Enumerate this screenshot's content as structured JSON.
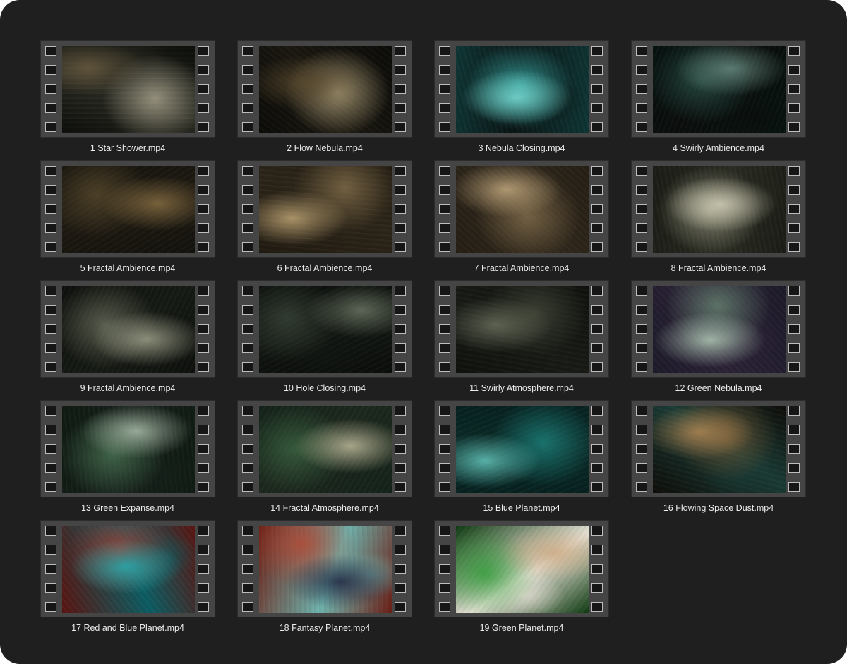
{
  "files": [
    {
      "label": "1 Star Shower.mp4",
      "colors": [
        "#0c0e0a",
        "#b9b39b",
        "#6e5f43",
        "#2a2a22"
      ]
    },
    {
      "label": "2 Flow Nebula.mp4",
      "colors": [
        "#0b0b08",
        "#c7b58a",
        "#5a4a2e",
        "#1a1710"
      ]
    },
    {
      "label": "3 Nebula Closing.mp4",
      "colors": [
        "#0e3534",
        "#3fbfba",
        "#7ee0d8",
        "#0a1414"
      ]
    },
    {
      "label": "4 Swirly Ambience.mp4",
      "colors": [
        "#071310",
        "#2f5b51",
        "#6b8f84",
        "#0a0d0c"
      ]
    },
    {
      "label": "5 Fractal Ambience.mp4",
      "colors": [
        "#13120c",
        "#5d4d2f",
        "#8c7245",
        "#1f1a12"
      ]
    },
    {
      "label": "6 Fractal Ambience.mp4",
      "colors": [
        "#201a11",
        "#8c7650",
        "#c9ae7b",
        "#2b2418"
      ]
    },
    {
      "label": "7 Fractal Ambience.mp4",
      "colors": [
        "#251e14",
        "#8a7451",
        "#c8ad82",
        "#30281c"
      ]
    },
    {
      "label": "8 Fractal Ambience.mp4",
      "colors": [
        "#1a1c15",
        "#a6a58e",
        "#d7d4bd",
        "#2a2b22"
      ]
    },
    {
      "label": "9 Fractal Ambience.mp4",
      "colors": [
        "#0d100c",
        "#6f7462",
        "#a7a892",
        "#161a14"
      ]
    },
    {
      "label": "10 Hole Closing.mp4",
      "colors": [
        "#0a0d0a",
        "#3e4a3d",
        "#6f7b68",
        "#121612"
      ]
    },
    {
      "label": "11 Swirly Atmosphere.mp4",
      "colors": [
        "#0f110d",
        "#454a3c",
        "#6d725f",
        "#181a15"
      ]
    },
    {
      "label": "12 Green Nebula.mp4",
      "colors": [
        "#1d1a2a",
        "#6e8f78",
        "#b8d1bd",
        "#2b2236"
      ]
    },
    {
      "label": "13 Green Expanse.mp4",
      "colors": [
        "#0f1a12",
        "#4e7a59",
        "#b3c5b2",
        "#16201a"
      ]
    },
    {
      "label": "14 Fractal Atmosphere.mp4",
      "colors": [
        "#142219",
        "#3f6b46",
        "#c9c4a3",
        "#1c271d"
      ]
    },
    {
      "label": "15 Blue Planet.mp4",
      "colors": [
        "#06211f",
        "#1f8b86",
        "#6ad1c7",
        "#0b2a27"
      ]
    },
    {
      "label": "16 Flowing Space Dust.mp4",
      "colors": [
        "#0e0d09",
        "#7a5a34",
        "#b58a55",
        "#1a3a34"
      ]
    },
    {
      "label": "17 Red and Blue Planet.mp4",
      "colors": [
        "#5a1410",
        "#c0392b",
        "#1fb5b9",
        "#0b5d63"
      ]
    },
    {
      "label": "18 Fantasy Planet.mp4",
      "colors": [
        "#6b1d14",
        "#c0452e",
        "#1a1c3a",
        "#6fb3ad"
      ]
    },
    {
      "label": "19 Green Planet.mp4",
      "colors": [
        "#0d3a10",
        "#1f9a2a",
        "#c9a47a",
        "#e9e4d9"
      ]
    }
  ]
}
